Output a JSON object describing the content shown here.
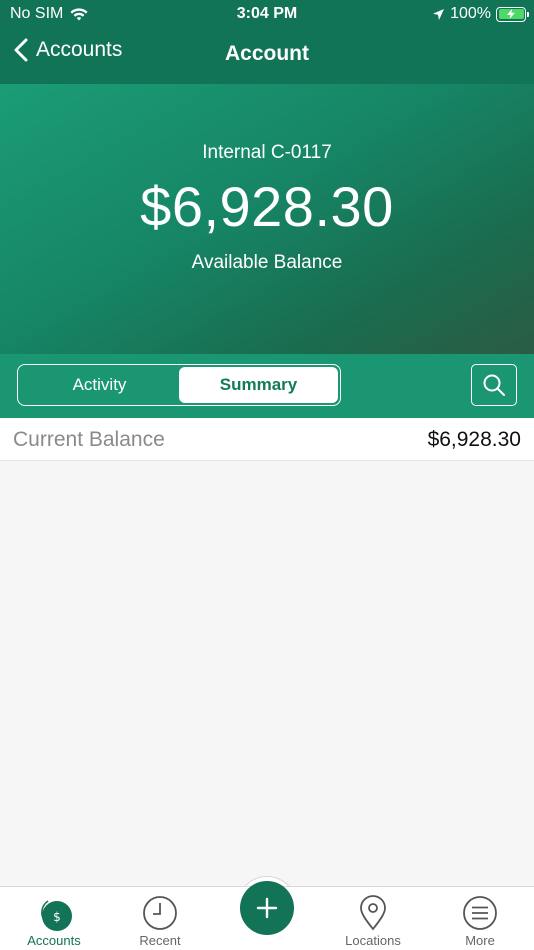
{
  "status_bar": {
    "carrier": "No SIM",
    "time": "3:04 PM",
    "battery": "100%",
    "icons": [
      "wifi-icon",
      "location-arrow-icon",
      "battery-charging-icon"
    ]
  },
  "nav": {
    "back_label": "Accounts",
    "title": "Account"
  },
  "hero": {
    "account_name": "Internal C-0117",
    "amount": "$6,928.30",
    "label": "Available Balance"
  },
  "segmented": {
    "tabs": [
      {
        "label": "Activity",
        "active": false
      },
      {
        "label": "Summary",
        "active": true
      }
    ]
  },
  "summary": {
    "rows": [
      {
        "label": "Current Balance",
        "value": "$6,928.30"
      }
    ]
  },
  "tab_bar": {
    "items": [
      {
        "label": "Accounts",
        "icon": "dollar-circle-icon",
        "active": true
      },
      {
        "label": "Recent",
        "icon": "clock-icon",
        "active": false
      },
      {
        "label": "",
        "icon": "plus-icon",
        "active": false
      },
      {
        "label": "Locations",
        "icon": "map-pin-icon",
        "active": false
      },
      {
        "label": "More",
        "icon": "menu-icon",
        "active": false
      }
    ]
  },
  "colors": {
    "primary": "#137356",
    "hero_start": "#1b9c77",
    "hero_end": "#2b5c44",
    "segment_bar": "#1a9772",
    "battery": "#4cd964"
  }
}
